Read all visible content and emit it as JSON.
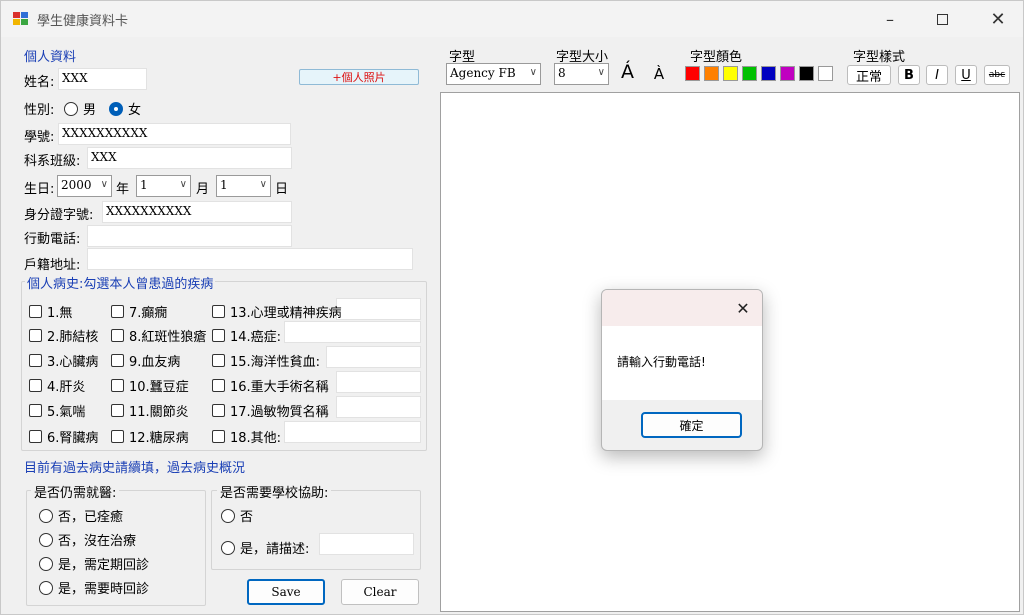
{
  "window": {
    "title": "學生健康資料卡"
  },
  "personal": {
    "group_title": "個人資料",
    "name_label": "姓名:",
    "name_value": "XXX",
    "photo_button": "+個人照片",
    "gender_label": "性別:",
    "gender_male": "男",
    "gender_female": "女",
    "gender_selected": "女",
    "student_id_label": "學號:",
    "student_id_value": "XXXXXXXXXX",
    "dept_label": "科系班級:",
    "dept_value": "XXX",
    "birth_label": "生日:",
    "birth_year": "2000",
    "year_unit": "年",
    "birth_month": "1",
    "month_unit": "月",
    "birth_day": "1",
    "day_unit": "日",
    "id_label": "身分證字號:",
    "id_value": "XXXXXXXXXX",
    "phone_label": "行動電話:",
    "phone_value": "",
    "address_label": "戶籍地址:",
    "address_value": ""
  },
  "history": {
    "group_title": "個人病史:勾選本人曾患過的疾病",
    "col1": [
      "1.無",
      "2.肺結核",
      "3.心臟病",
      "4.肝炎",
      "5.氣喘",
      "6.腎臟病"
    ],
    "col2": [
      "7.癲癇",
      "8.紅斑性狼瘡",
      "9.血友病",
      "10.蠶豆症",
      "11.關節炎",
      "12.糖尿病"
    ],
    "col3": [
      "13.心理或精神疾病",
      "14.癌症:",
      "15.海洋性貧血:",
      "16.重大手術名稱",
      "17.過敏物質名稱",
      "18.其他:"
    ]
  },
  "past": {
    "title": "目前有過去病史請續填，過去病史概況",
    "medical_group_title": "是否仍需就醫:",
    "medical_options": [
      "否，已痊癒",
      "否，沒在治療",
      "是，需定期回診",
      "是，需要時回診"
    ],
    "school_group_title": "是否需要學校協助:",
    "school_options": [
      "否",
      "是，請描述:"
    ]
  },
  "buttons": {
    "save": "Save",
    "clear": "Clear"
  },
  "toolbar": {
    "font_label": "字型",
    "font_value": "Agency FB",
    "size_label": "字型大小",
    "size_value": "8",
    "color_label": "字型顏色",
    "style_label": "字型樣式",
    "regular_label": "正常",
    "bold_label": "B",
    "italic_label": "I",
    "underline_label": "U",
    "strike_label": "abc",
    "colors": [
      "#ff0000",
      "#ff8000",
      "#ffff00",
      "#00c000",
      "#0000c0",
      "#c000c0",
      "#000000",
      "#ffffff"
    ]
  },
  "dialog": {
    "message": "請輸入行動電話!",
    "ok_label": "確定"
  }
}
